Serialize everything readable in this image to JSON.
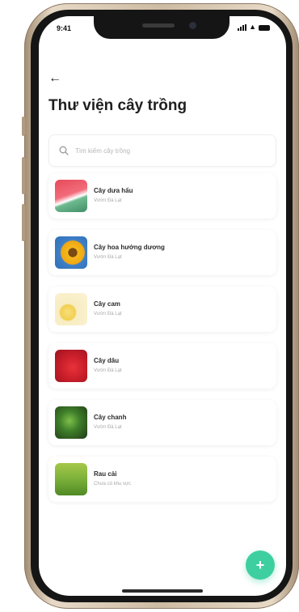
{
  "status_bar": {
    "time": "9:41"
  },
  "header": {
    "title": "Thư viện cây trồng"
  },
  "search": {
    "placeholder": "Tìm kiếm cây trồng"
  },
  "plants": [
    {
      "name": "Cây dưa hấu",
      "location": "Vườn Đà Lạt",
      "icon": "watermelon-image"
    },
    {
      "name": "Cây hoa hướng dương",
      "location": "Vườn Đà Lạt",
      "icon": "sunflower-image"
    },
    {
      "name": "Cây cam",
      "location": "Vườn Đà Lạt",
      "icon": "orange-image"
    },
    {
      "name": "Cây dâu",
      "location": "Vườn Đà Lạt",
      "icon": "strawberry-image"
    },
    {
      "name": "Cây chanh",
      "location": "Vườn Đà Lạt",
      "icon": "lemon-leaves-image"
    },
    {
      "name": "Rau cải",
      "location": "Chưa có khu vực",
      "icon": "greens-image"
    }
  ],
  "fab": {
    "label": "+"
  },
  "colors": {
    "accent": "#3ecfa0",
    "title": "#1f1f1f",
    "subtext": "#a9a9a9"
  }
}
